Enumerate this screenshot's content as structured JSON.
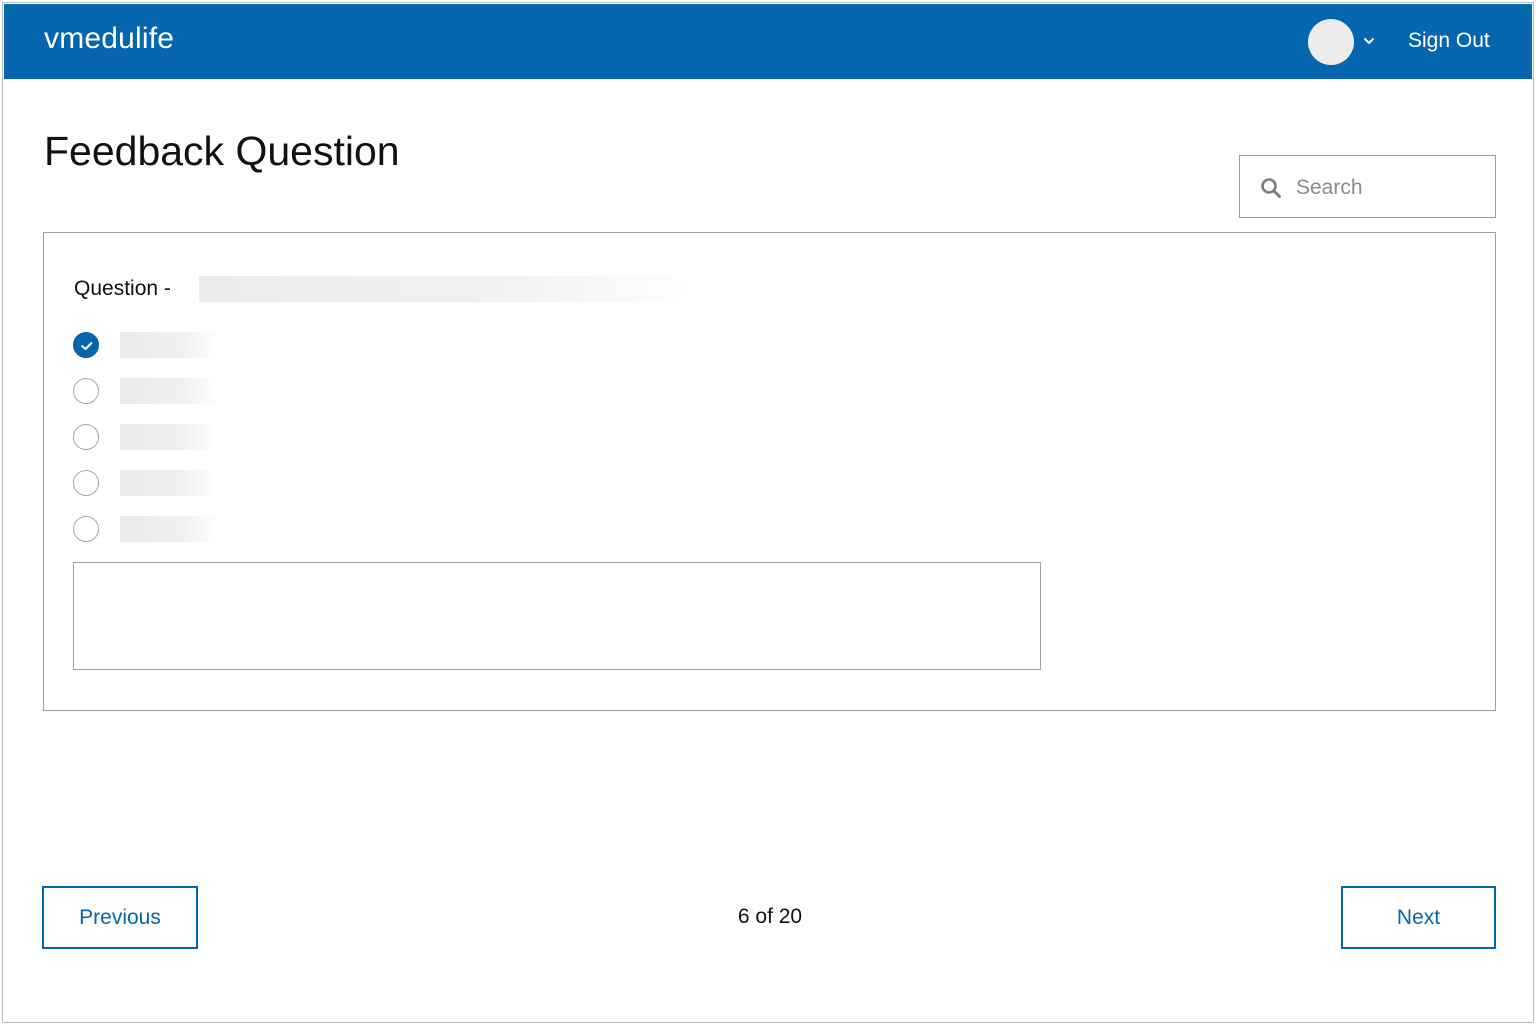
{
  "app": {
    "title": "vmedulife",
    "sign_out_label": "Sign Out",
    "accent_color": "#0565ad"
  },
  "page": {
    "title": "Feedback Question"
  },
  "search": {
    "placeholder": "Search",
    "value": "",
    "icon": "search-icon"
  },
  "question": {
    "label": "Question -",
    "options": [
      {
        "checked": true
      },
      {
        "checked": false
      },
      {
        "checked": false
      },
      {
        "checked": false
      },
      {
        "checked": false
      }
    ],
    "comment_value": ""
  },
  "pagination": {
    "previous_label": "Previous",
    "next_label": "Next",
    "current": 6,
    "total": 20,
    "text": "6 of 20"
  }
}
